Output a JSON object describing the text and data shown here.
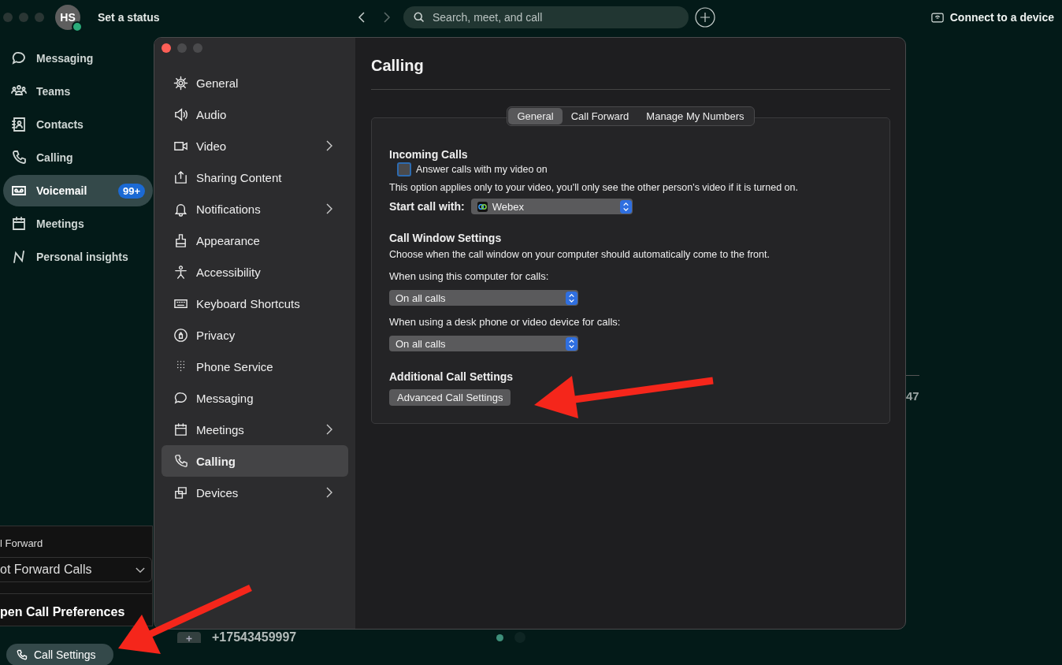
{
  "top_bar": {
    "avatar_initials": "HS",
    "online": true,
    "status_label": "Set a status",
    "search": {
      "placeholder": "Search, meet, and call"
    },
    "connect_label": "Connect to a device"
  },
  "nav": [
    {
      "label": "Messaging",
      "selected": false
    },
    {
      "label": "Teams",
      "selected": false
    },
    {
      "label": "Contacts",
      "selected": false
    },
    {
      "label": "Calling",
      "selected": false
    },
    {
      "label": "Voicemail",
      "selected": true,
      "badge": "99+"
    },
    {
      "label": "Meetings",
      "selected": false
    },
    {
      "label": "Personal insights",
      "selected": false
    }
  ],
  "call_popover": {
    "forward_label": "l Forward",
    "forward_value": "ot Forward Calls",
    "preferences_link": "pen Call Preferences"
  },
  "call_settings_button": "Call Settings",
  "background": {
    "row_number": "+17543459997",
    "side_value": "47"
  },
  "settings_window": {
    "title": "Calling",
    "nav": [
      {
        "label": "General",
        "selected": false,
        "submenu": false
      },
      {
        "label": "Audio",
        "selected": false,
        "submenu": false
      },
      {
        "label": "Video",
        "selected": false,
        "submenu": true
      },
      {
        "label": "Sharing Content",
        "selected": false,
        "submenu": false
      },
      {
        "label": "Notifications",
        "selected": false,
        "submenu": true
      },
      {
        "label": "Appearance",
        "selected": false,
        "submenu": false
      },
      {
        "label": "Accessibility",
        "selected": false,
        "submenu": false
      },
      {
        "label": "Keyboard Shortcuts",
        "selected": false,
        "submenu": false
      },
      {
        "label": "Privacy",
        "selected": false,
        "submenu": false
      },
      {
        "label": "Phone Service",
        "selected": false,
        "submenu": false
      },
      {
        "label": "Messaging",
        "selected": false,
        "submenu": false
      },
      {
        "label": "Meetings",
        "selected": false,
        "submenu": true
      },
      {
        "label": "Calling",
        "selected": true,
        "submenu": false
      },
      {
        "label": "Devices",
        "selected": false,
        "submenu": true
      }
    ],
    "tabs": [
      {
        "label": "General",
        "selected": true
      },
      {
        "label": "Call Forward",
        "selected": false
      },
      {
        "label": "Manage My Numbers",
        "selected": false
      }
    ],
    "incoming": {
      "heading": "Incoming Calls",
      "checkbox": {
        "label": "Answer calls with my video on",
        "checked": false
      },
      "note": "This option applies only to your video, you'll only see the other person's video if it is turned on.",
      "start_label": "Start call with:",
      "start_value": "Webex"
    },
    "call_window": {
      "heading": "Call Window Settings",
      "description": "Choose when the call window on your computer should automatically come to the front.",
      "fields": [
        {
          "label": "When using this computer for calls:",
          "value": "On all calls"
        },
        {
          "label": "When using a desk phone or video device for calls:",
          "value": "On all calls"
        }
      ]
    },
    "additional": {
      "heading": "Additional Call Settings",
      "button": "Advanced Call Settings"
    }
  }
}
